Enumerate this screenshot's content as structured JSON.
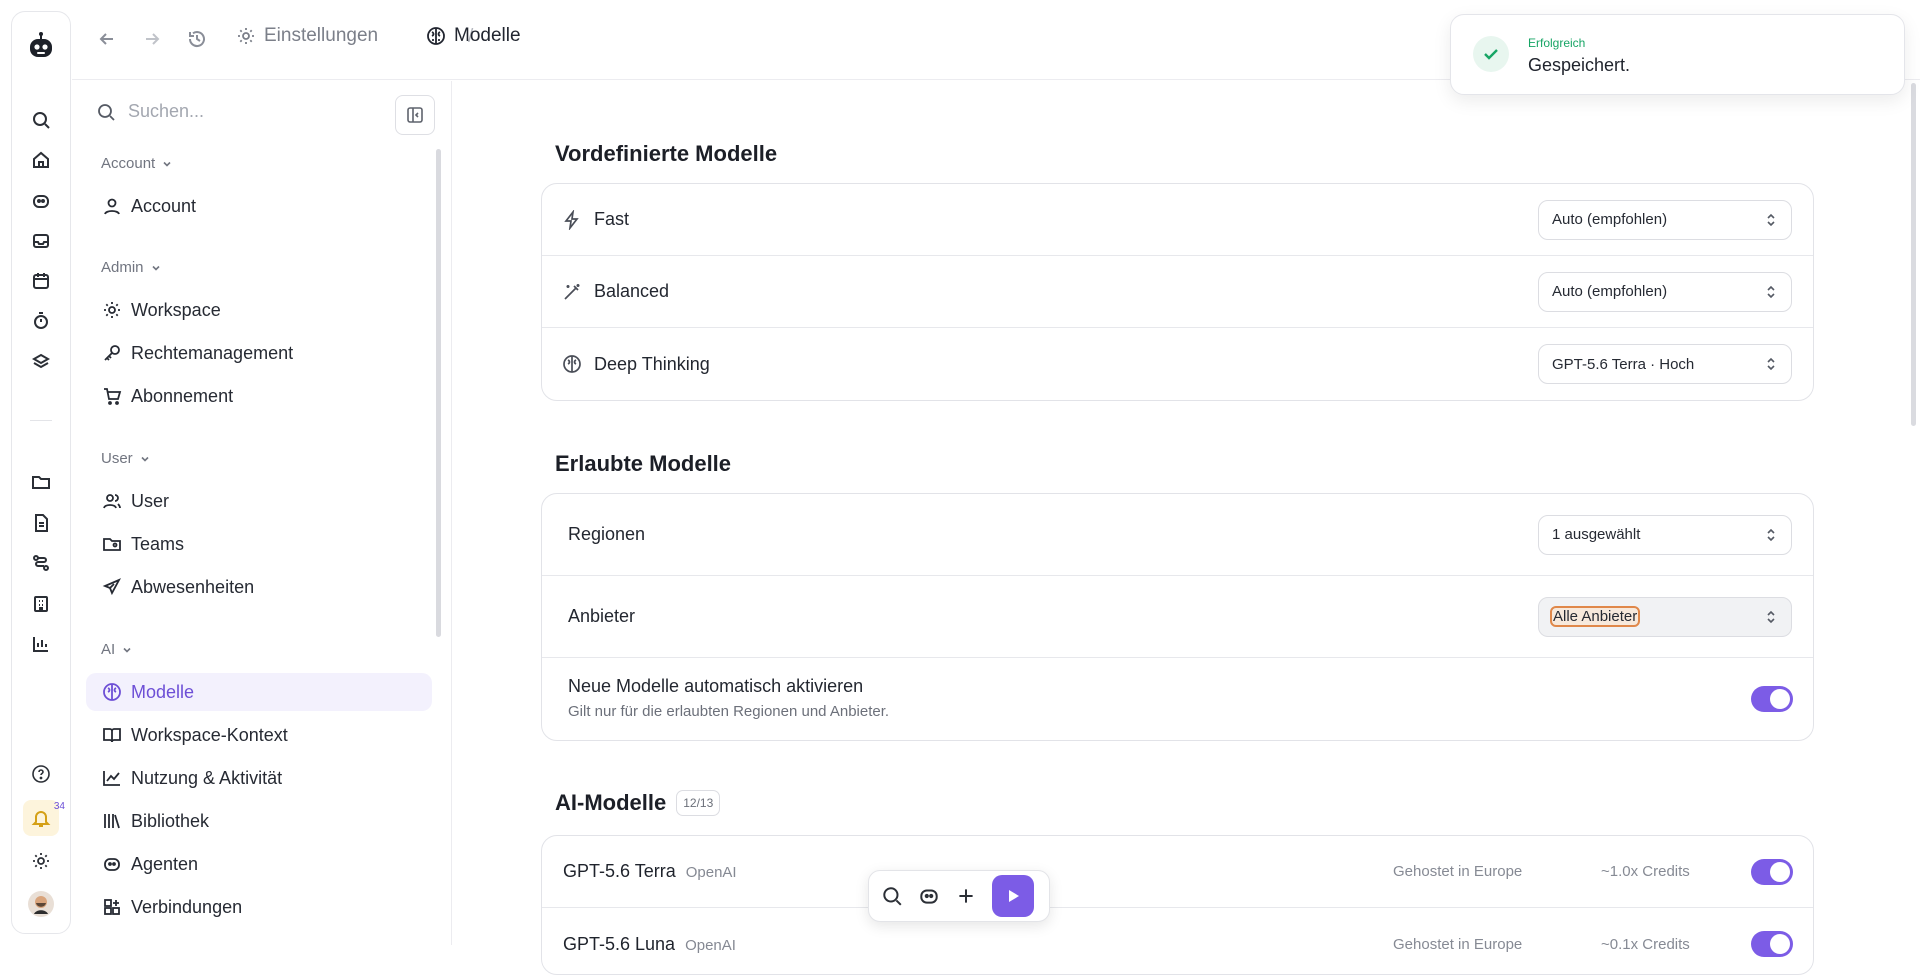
{
  "breadcrumb": {
    "settings": "Einstellungen",
    "separator": "/",
    "current": "Modelle"
  },
  "search": {
    "placeholder": "Suchen..."
  },
  "rail": {
    "notification_count": "34"
  },
  "sidebar": {
    "groups": [
      {
        "title": "Account",
        "items": [
          "Account"
        ]
      },
      {
        "title": "Admin",
        "items": [
          "Workspace",
          "Rechtemanagement",
          "Abonnement"
        ]
      },
      {
        "title": "User",
        "items": [
          "User",
          "Teams",
          "Abwesenheiten"
        ]
      },
      {
        "title": "AI",
        "items": [
          "Modelle",
          "Workspace-Kontext",
          "Nutzung & Aktivität",
          "Bibliothek",
          "Agenten",
          "Verbindungen"
        ]
      }
    ]
  },
  "predefined": {
    "title": "Vordefinierte Modelle",
    "rows": [
      {
        "label": "Fast",
        "value": "Auto (empfohlen)",
        "icon": "lightning-icon"
      },
      {
        "label": "Balanced",
        "value": "Auto (empfohlen)",
        "icon": "magic-wand-icon"
      },
      {
        "label": "Deep Thinking",
        "value": "GPT-5.6 Terra · Hoch",
        "icon": "brain-icon"
      }
    ]
  },
  "allowed": {
    "title": "Erlaubte Modelle",
    "regions_label": "Regionen",
    "regions_value": "1 ausgewählt",
    "providers_label": "Anbieter",
    "providers_value": "Alle Anbieter",
    "auto_label": "Neue Modelle automatisch aktivieren",
    "auto_sub": "Gilt nur für die erlaubten Regionen und Anbieter.",
    "auto_enabled": true
  },
  "ai_models": {
    "title": "AI-Modelle",
    "count": "12/13",
    "rows": [
      {
        "name": "GPT-5.6 Terra",
        "provider": "OpenAI",
        "hosting": "Gehostet in Europe",
        "credits": "~1.0x Credits",
        "enabled": true
      },
      {
        "name": "GPT-5.6 Luna",
        "provider": "OpenAI",
        "hosting": "Gehostet in Europe",
        "credits": "~0.1x Credits",
        "enabled": true
      }
    ]
  },
  "toast": {
    "title": "Erfolgreich",
    "message": "Gespeichert."
  },
  "colors": {
    "accent": "#7c5ce6",
    "success": "#17a565",
    "highlight": "#e0884a"
  }
}
